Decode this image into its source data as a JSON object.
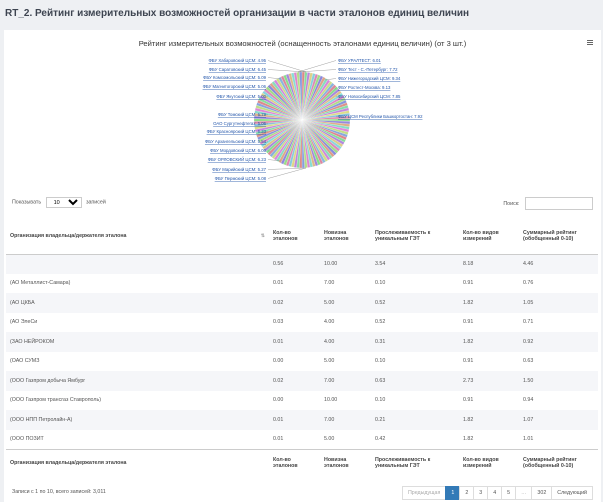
{
  "page": {
    "title": "RT_2. Рейтинг измерительных возможностей организации в части эталонов единиц величин"
  },
  "chart": {
    "title": "Рейтинг измерительных возможностей (оснащенность эталонами единиц величин) (от 3 шт.)"
  },
  "chart_data": {
    "type": "pie",
    "title": "Рейтинг измерительных возможностей (оснащенность эталонами единиц величин) (от 3 шт.)",
    "visible_labels": [
      {
        "label": "ФБУ Хабаровский ЦСМ",
        "value": 4.95
      },
      {
        "label": "ФБУ Саратовский ЦСМ",
        "value": 6.45
      },
      {
        "label": "ФБУ Комсомольский ЦСМ",
        "value": 5.09
      },
      {
        "label": "ФБУ Магнитогорский ЦСМ",
        "value": 5.06
      },
      {
        "label": "ФБУ Якутский ЦСМ",
        "value": 5.0
      },
      {
        "label": "ФБУ Томский ЦСМ",
        "value": 5.79
      },
      {
        "label": "ОАО Сургутнефтегаз",
        "value": 5.06
      },
      {
        "label": "ФБУ Красноярский ЦСМ",
        "value": 6.33
      },
      {
        "label": "ФБУ Архангельский ЦСМ",
        "value": 5.54
      },
      {
        "label": "ФБУ Мордовский ЦСМ",
        "value": 6.06
      },
      {
        "label": "ФБУ ОРЛОВСКИЙ ЦСМ",
        "value": 6.23
      },
      {
        "label": "ФБУ Марийский ЦСМ",
        "value": 5.27
      },
      {
        "label": "ФБУ Пермский ЦСМ",
        "value": 5.08
      },
      {
        "label": "ФБУ УРАЛТЕСТ",
        "value": 6.01
      },
      {
        "label": "ФБУ Тест - С.-Петербург",
        "value": 7.72
      },
      {
        "label": "ФБУ Нижегородский ЦСМ",
        "value": 9.34
      },
      {
        "label": "ФБУ Ростест-Москва",
        "value": 9.13
      },
      {
        "label": "ФБУ Новосибирский ЦСМ",
        "value": 7.85
      },
      {
        "label": "ФБУ ЦСМ Республики Башкортостан",
        "value": 7.92
      }
    ]
  },
  "controls": {
    "show_label": "Показывать",
    "page_size": "10",
    "records_label": "записей",
    "search_label": "Поиск:"
  },
  "table": {
    "headers": [
      "Организация владельца/держателя эталона",
      "Кол-во эталонов",
      "Новизна эталонов",
      "Прослеживаемость к уникальным ГЭТ",
      "Кол-во видов измерений",
      "Суммарный рейтинг (обобщенный 0-10)"
    ],
    "rows": [
      [
        "",
        "0.56",
        "10.00",
        "3.54",
        "8.18",
        "4.46"
      ],
      [
        "(АО Металлист-Самара)",
        "0.01",
        "7.00",
        "0.10",
        "0.91",
        "0.76"
      ],
      [
        "(АО ЦКБА",
        "0.02",
        "5.00",
        "0.52",
        "1.82",
        "1.05"
      ],
      [
        "(АО ЭлеСи",
        "0.03",
        "4.00",
        "0.52",
        "0.91",
        "0.71"
      ],
      [
        "(ЗАО НЕЙРОКОМ",
        "0.01",
        "4.00",
        "0.31",
        "1.82",
        "0.92"
      ],
      [
        "(ОАО СУМЗ",
        "0.00",
        "5.00",
        "0.10",
        "0.91",
        "0.63"
      ],
      [
        "(ООО Газпром добыча Ямбург",
        "0.02",
        "7.00",
        "0.63",
        "2.73",
        "1.50"
      ],
      [
        "(ООО Газпром трансгаз Ставрополь)",
        "0.00",
        "10.00",
        "0.10",
        "0.91",
        "0.94"
      ],
      [
        "(ООО НПП Петролайн-А)",
        "0.01",
        "7.00",
        "0.21",
        "1.82",
        "1.07"
      ],
      [
        "(ООО ПОЗИТ",
        "0.01",
        "5.00",
        "0.42",
        "1.82",
        "1.01"
      ]
    ]
  },
  "info": "Записи с 1 по 10, всего записей: 3,011",
  "pagination": {
    "prev": "Предыдущая",
    "pages": [
      "1",
      "2",
      "3",
      "4",
      "5",
      "…",
      "302"
    ],
    "next": "Следующий"
  }
}
